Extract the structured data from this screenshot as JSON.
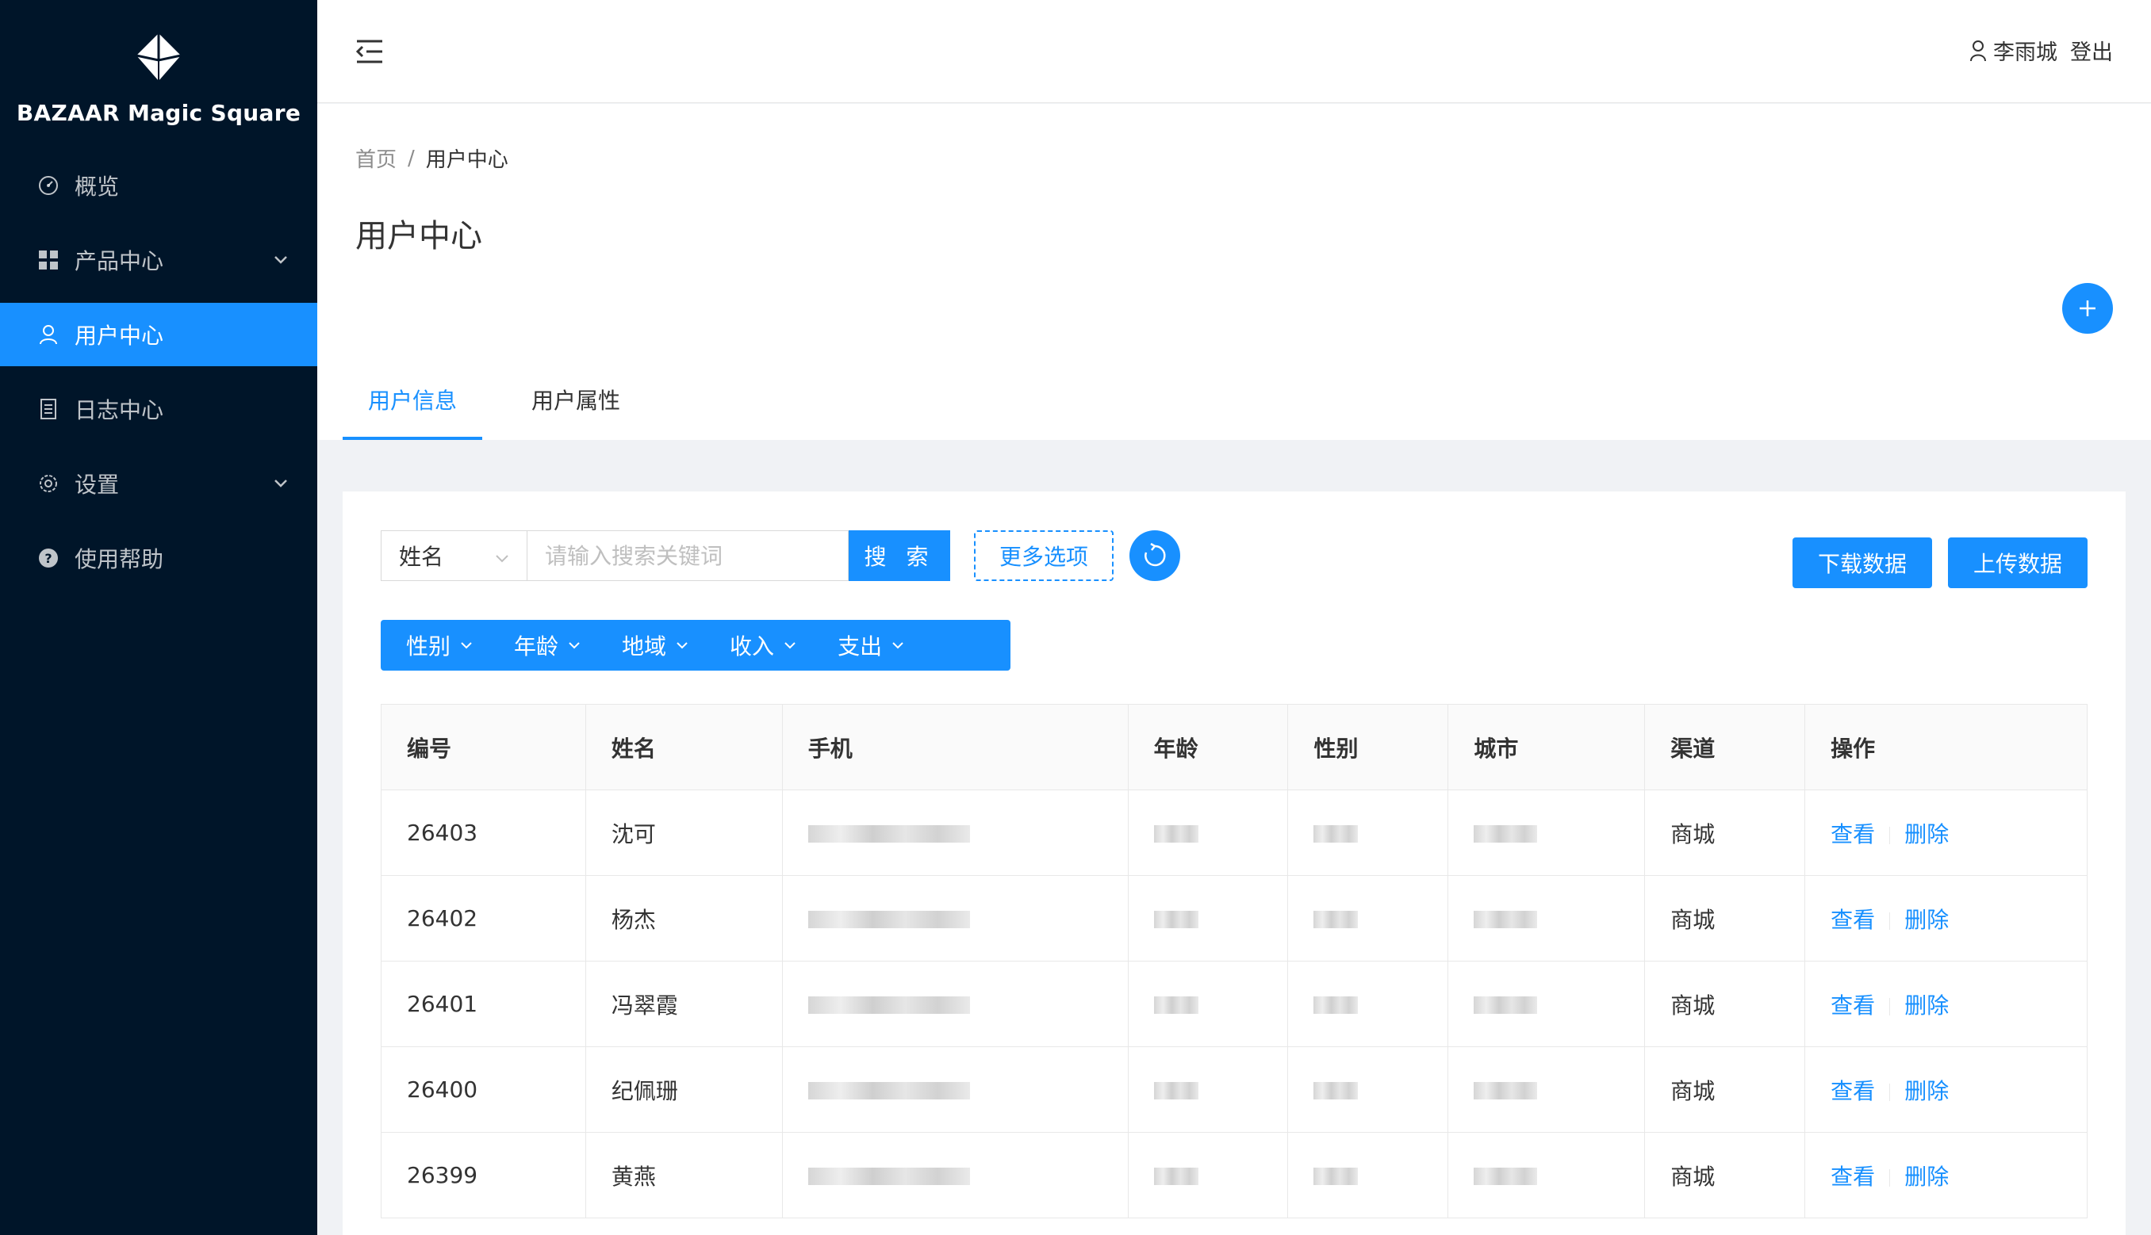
{
  "app": {
    "brand": "BAZAAR Magic Square"
  },
  "sidebar": {
    "items": [
      {
        "label": "概览",
        "icon": "dashboard-icon"
      },
      {
        "label": "产品中心",
        "icon": "appstore-icon",
        "expandable": true
      },
      {
        "label": "用户中心",
        "icon": "user-icon",
        "active": true
      },
      {
        "label": "日志中心",
        "icon": "file-icon"
      },
      {
        "label": "设置",
        "icon": "setting-icon",
        "expandable": true
      },
      {
        "label": "使用帮助",
        "icon": "question-icon"
      }
    ]
  },
  "header": {
    "username": "李雨城",
    "logout": "登出"
  },
  "breadcrumb": {
    "home": "首页",
    "separator": "/",
    "current": "用户中心"
  },
  "page": {
    "title": "用户中心"
  },
  "tabs": [
    {
      "label": "用户信息",
      "active": true
    },
    {
      "label": "用户属性"
    }
  ],
  "search": {
    "select_value": "姓名",
    "placeholder": "请输入搜索关键词",
    "button": "搜 索",
    "more": "更多选项"
  },
  "actions": {
    "download": "下载数据",
    "upload": "上传数据"
  },
  "filters": [
    "性别",
    "年龄",
    "地域",
    "收入",
    "支出"
  ],
  "table": {
    "columns": [
      "编号",
      "姓名",
      "手机",
      "年龄",
      "性别",
      "城市",
      "渠道",
      "操作"
    ],
    "rows": [
      {
        "id": "26403",
        "name": "沈可",
        "channel": "商城"
      },
      {
        "id": "26402",
        "name": "杨杰",
        "channel": "商城"
      },
      {
        "id": "26401",
        "name": "冯翠霞",
        "channel": "商城"
      },
      {
        "id": "26400",
        "name": "纪佩珊",
        "channel": "商城"
      },
      {
        "id": "26399",
        "name": "黄燕",
        "channel": "商城"
      }
    ],
    "view": "查看",
    "delete": "删除"
  },
  "colors": {
    "primary": "#1890ff",
    "sidebar_bg": "#001529"
  }
}
